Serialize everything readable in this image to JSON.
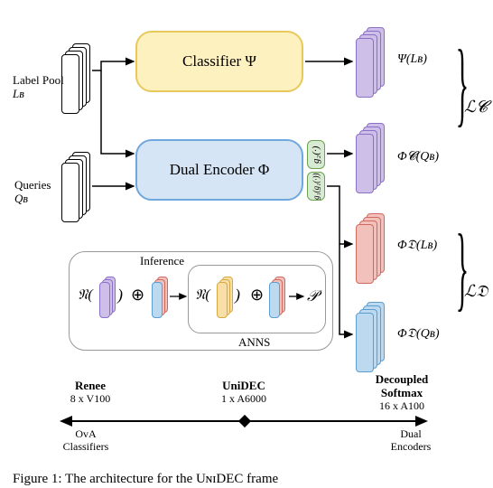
{
  "inputs": {
    "label_pool_label": "Label Pool",
    "label_pool_sym": "Lʙ",
    "queries_label": "Queries",
    "queries_sym": "Qʙ"
  },
  "classifier": {
    "label": "Classifier Ψ"
  },
  "encoder": {
    "label": "Dual Encoder Φ"
  },
  "heads": {
    "g2": "g₂(·)",
    "g1": "g₁(g₁(·))"
  },
  "outputs": {
    "psi": "Ψ(Lʙ)",
    "phi_c": "Φ𝓒(Qʙ)",
    "phi_d_l": "Φ𝔇(Lʙ)",
    "phi_d_q": "Φ𝔇(Qʙ)"
  },
  "losses": {
    "lc": "ℒ𝓒",
    "ld": "ℒ𝔇"
  },
  "inference": {
    "label": "Inference",
    "anns": "ANNS",
    "n_open": "𝔑(",
    "n_close": ")",
    "plus": "⊕",
    "p": "𝒫"
  },
  "spectrum": {
    "renee_name": "Renee",
    "renee_gpu": "8 x V100",
    "unidec_name": "UniDEC",
    "unidec_gpu": "1 x A6000",
    "decoupled_name": "Decoupled\nSoftmax",
    "decoupled_gpu": "16 x A100",
    "left_axis": "OvA\nClassifiers",
    "right_axis": "Dual\nEncoders"
  },
  "caption": "Figure 1: The architecture for the UɴɪDEC frame"
}
